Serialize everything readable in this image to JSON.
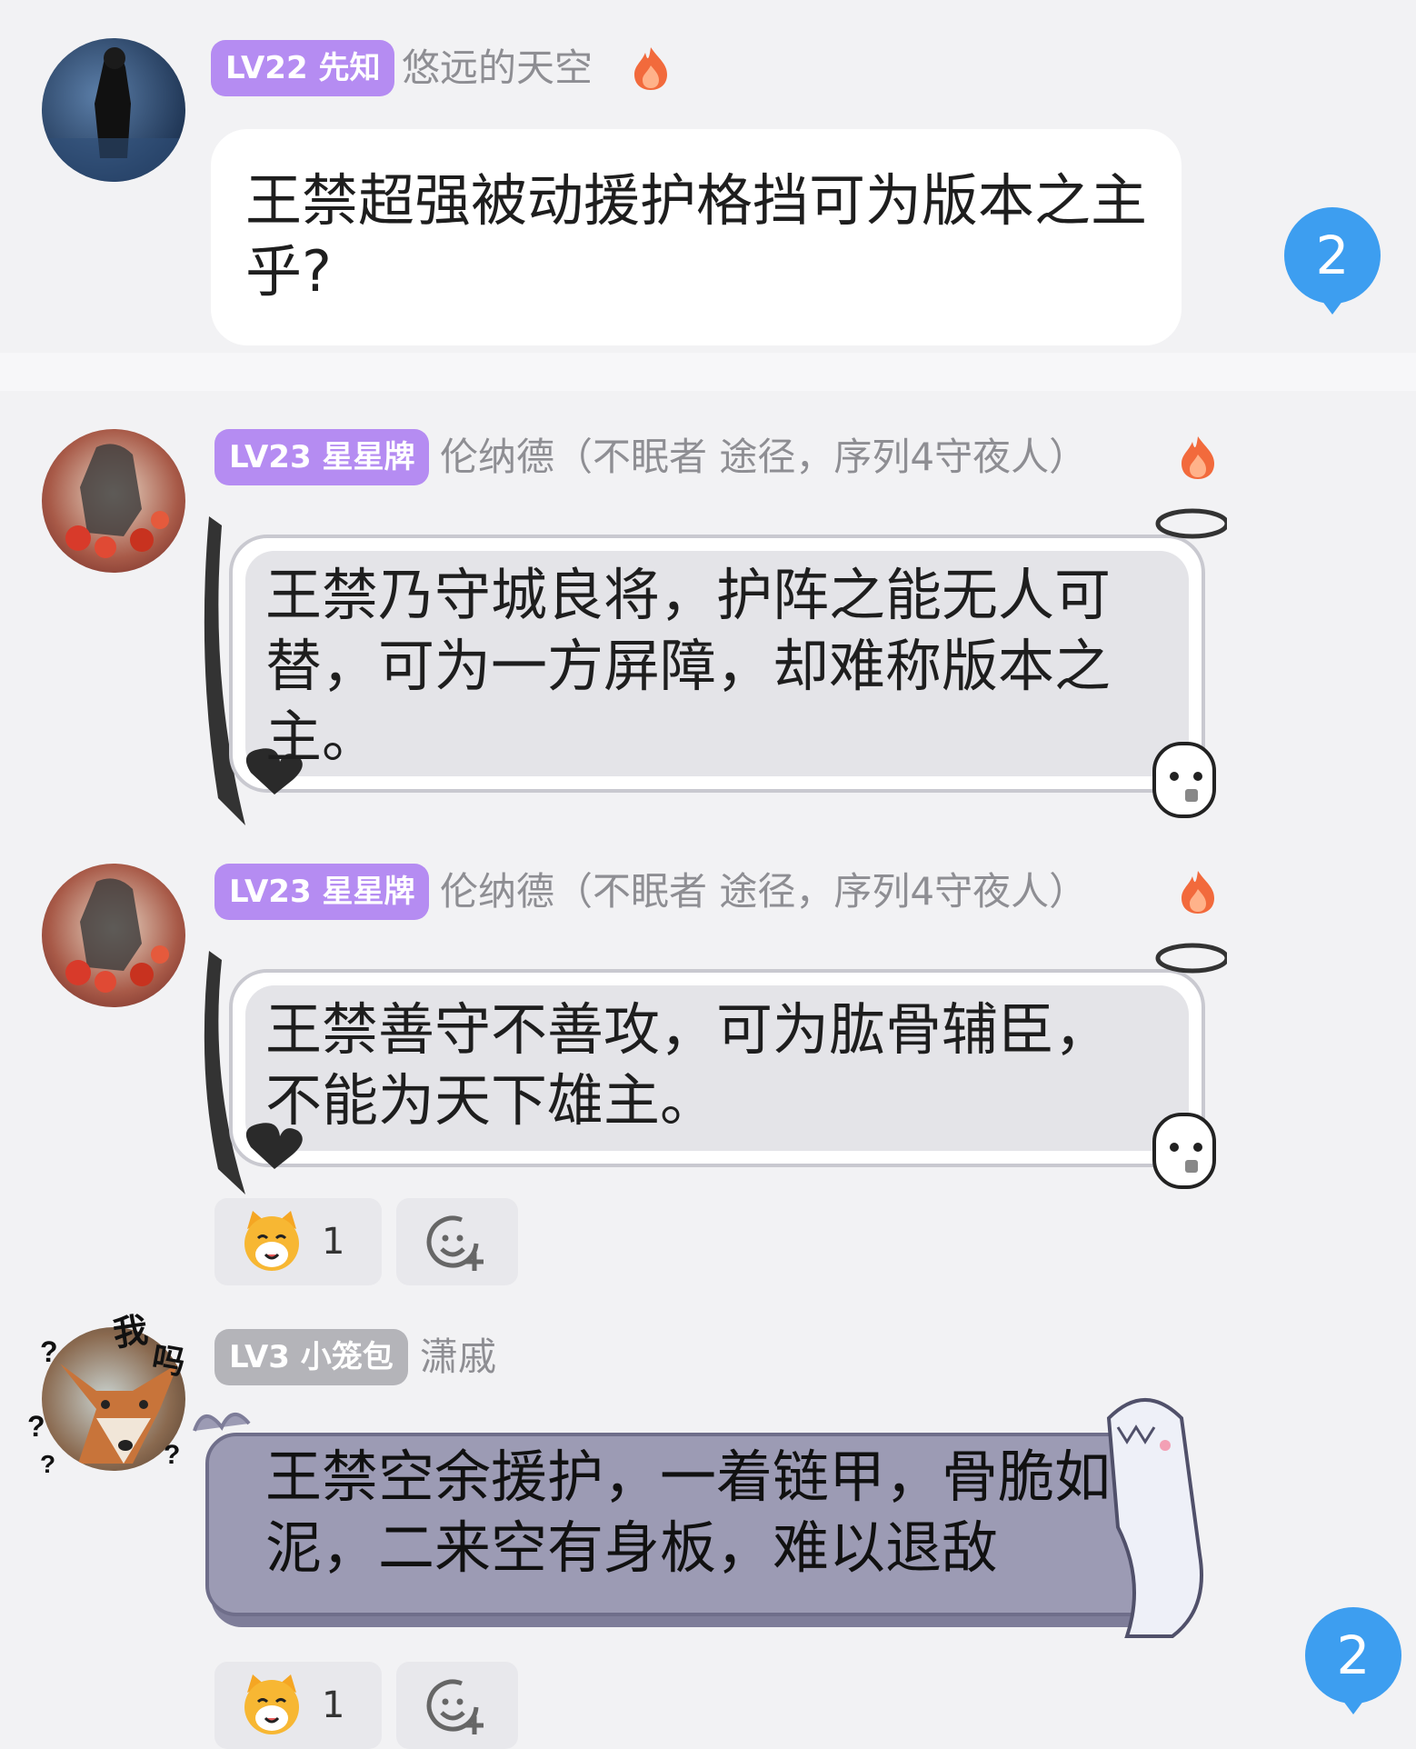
{
  "posts": [
    {
      "badge": "LV22 先知",
      "username": "悠远的天空",
      "text": "王禁超强被动援护格挡可为版本之主乎?",
      "reply_count": "2"
    },
    {
      "badge": "LV23 星星牌",
      "username": "伦纳德（不眠者 途径，序列4守夜人）",
      "text": "王禁乃守城良将，护阵之能无人可替，可为一方屏障，却难称版本之主。"
    },
    {
      "badge": "LV23 星星牌",
      "username": "伦纳德（不眠者 途径，序列4守夜人）",
      "text": "王禁善守不善攻，可为肱骨辅臣，不能为天下雄主。",
      "reaction_count": "1"
    },
    {
      "badge": "LV3 小笼包",
      "username": "潇戚",
      "avatar_doodle": [
        "我",
        "吗"
      ],
      "text": "王禁空余援护，一着链甲，骨脆如泥，二来空有身板，难以退敌",
      "reaction_count": "1",
      "reply_count": "2"
    }
  ],
  "colors": {
    "badge_purple": "#b58cf2",
    "badge_gray": "#b4b4b9",
    "reply_blue": "#3d9ef0",
    "bubble3_fill": "#9c9bb4"
  },
  "icons": [
    "flame-icon",
    "add-emoji-icon",
    "cat-emoji-icon",
    "speech-badge-icon"
  ]
}
